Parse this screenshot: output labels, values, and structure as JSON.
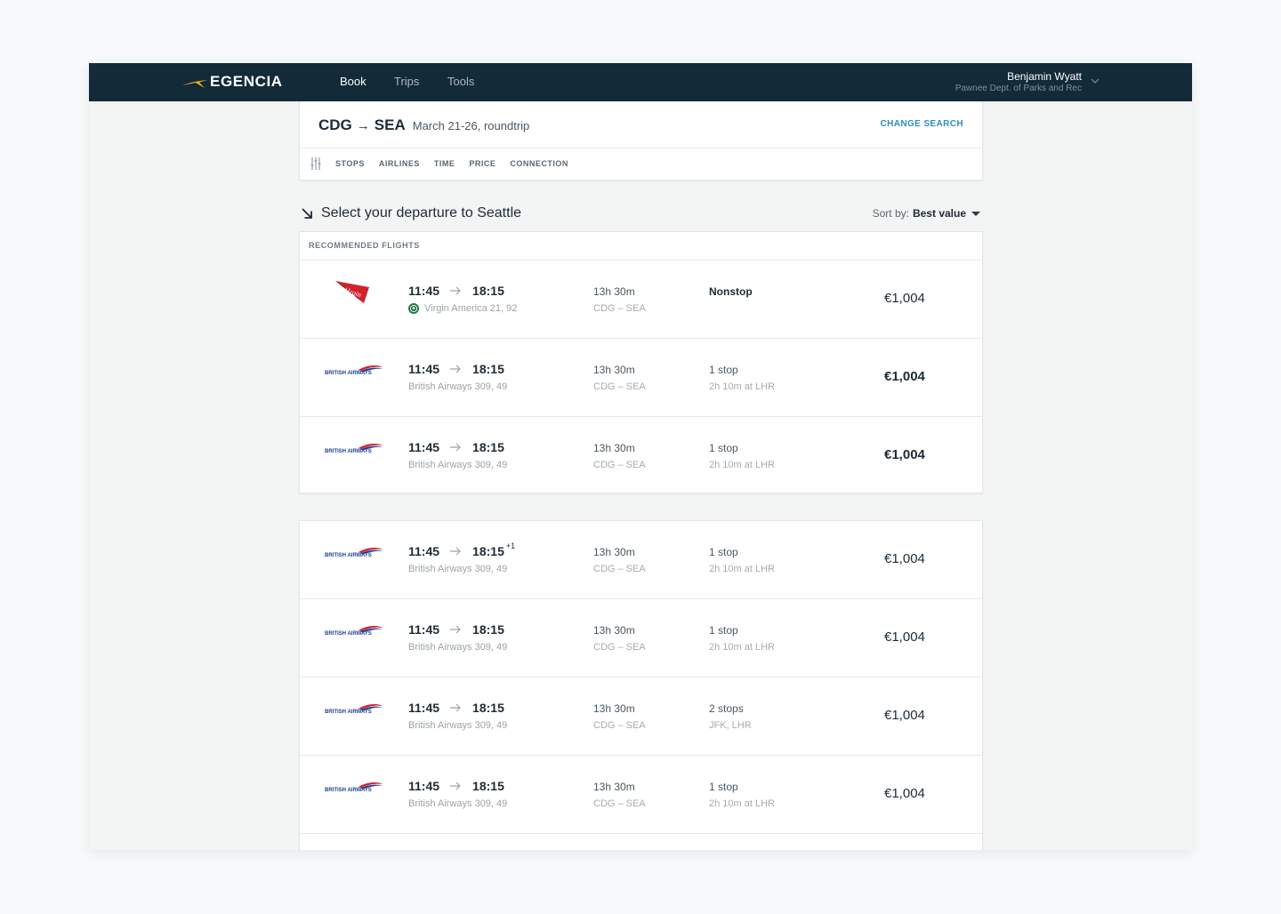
{
  "brand": {
    "name": "EGENCIA",
    "accent": "#f3b21c",
    "nav_bg": "#132a38"
  },
  "nav": [
    {
      "label": "Book",
      "active": true
    },
    {
      "label": "Trips",
      "active": false
    },
    {
      "label": "Tools",
      "active": false
    }
  ],
  "user": {
    "name": "Benjamin Wyatt",
    "org": "Pawnee Dept. of Parks and Rec"
  },
  "search": {
    "from": "CDG",
    "to": "SEA",
    "dates": "March 21-26, roundtrip",
    "change_label": "CHANGE SEARCH",
    "filters": [
      "STOPS",
      "AIRLINES",
      "TIME",
      "PRICE",
      "CONNECTION"
    ]
  },
  "section": {
    "title": "Select your departure to Seattle",
    "sort_label": "Sort by:",
    "sort_value": "Best value"
  },
  "recommended": {
    "label": "RECOMMENDED FLIGHTS",
    "flights": [
      {
        "logo": "virgin-america-logo",
        "depart": "11:45",
        "arrive": "18:15",
        "plus_day": "",
        "airline": "Virgin America 21, 92",
        "amenity": "starbucks-icon",
        "duration": "13h 30m",
        "route": "CDG – SEA",
        "stops": "Nonstop",
        "stop_detail": "",
        "price": "€1,004",
        "stops_emphasis": true,
        "price_emphasis": false
      },
      {
        "logo": "british-airways-logo",
        "depart": "11:45",
        "arrive": "18:15",
        "plus_day": "",
        "airline": "British Airways 309, 49",
        "duration": "13h 30m",
        "route": "CDG – SEA",
        "stops": "1 stop",
        "stop_detail": "2h 10m at LHR",
        "price": "€1,004",
        "stops_emphasis": false,
        "price_emphasis": true
      },
      {
        "logo": "british-airways-logo",
        "depart": "11:45",
        "arrive": "18:15",
        "plus_day": "",
        "airline": "British Airways 309, 49",
        "duration": "13h 30m",
        "route": "CDG – SEA",
        "stops": "1 stop",
        "stop_detail": "2h 10m at LHR",
        "price": "€1,004",
        "stops_emphasis": false,
        "price_emphasis": true
      }
    ]
  },
  "others": {
    "flights": [
      {
        "logo": "british-airways-logo",
        "depart": "11:45",
        "arrive": "18:15",
        "plus_day": "+1",
        "airline": "British Airways 309, 49",
        "duration": "13h 30m",
        "route": "CDG – SEA",
        "stops": "1 stop",
        "stop_detail": "2h 10m at LHR",
        "price": "€1,004"
      },
      {
        "logo": "british-airways-logo",
        "depart": "11:45",
        "arrive": "18:15",
        "plus_day": "",
        "airline": "British Airways 309, 49",
        "duration": "13h 30m",
        "route": "CDG – SEA",
        "stops": "1 stop",
        "stop_detail": "2h 10m at LHR",
        "price": "€1,004"
      },
      {
        "logo": "british-airways-logo",
        "depart": "11:45",
        "arrive": "18:15",
        "plus_day": "",
        "airline": "British Airways 309, 49",
        "duration": "13h 30m",
        "route": "CDG – SEA",
        "stops": "2 stops",
        "stop_detail": "JFK, LHR",
        "price": "€1,004"
      },
      {
        "logo": "british-airways-logo",
        "depart": "11:45",
        "arrive": "18:15",
        "plus_day": "",
        "airline": "British Airways 309, 49",
        "duration": "13h 30m",
        "route": "CDG – SEA",
        "stops": "1 stop",
        "stop_detail": "2h 10m at LHR",
        "price": "€1,004"
      }
    ]
  },
  "logos": {
    "british_airways_text": "BRITISH AIRWAYS",
    "virgin_text": "Virgin"
  }
}
